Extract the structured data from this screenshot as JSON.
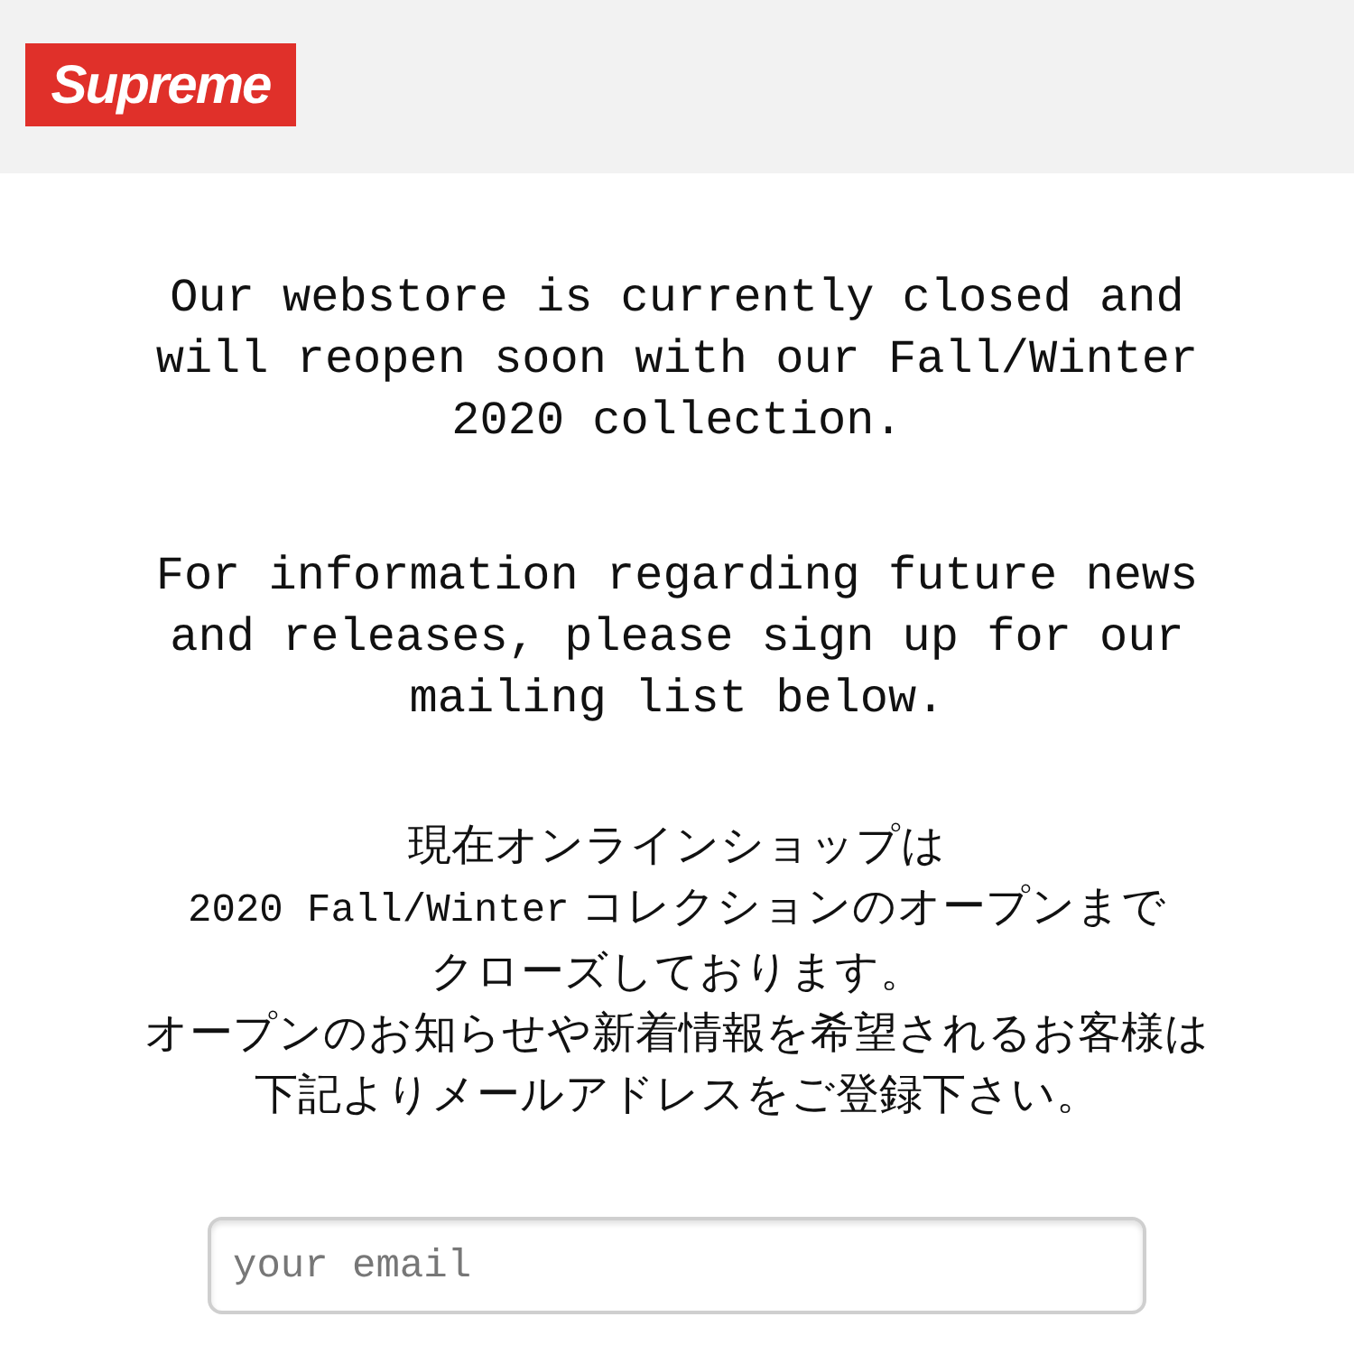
{
  "header": {
    "logo": "Supreme"
  },
  "notice_en": [
    "Our webstore is currently closed and will reopen soon with our Fall/Winter 2020 collection.",
    "For information regarding future news and releases, please sign up for our mailing list below."
  ],
  "notice_ja": [
    [
      {
        "kind": "ja",
        "text": "現在オンラインショップは"
      }
    ],
    [
      {
        "kind": "latin",
        "text": "2020 Fall/Winter"
      },
      {
        "kind": "ja",
        "text": " コレクションのオープンまで"
      }
    ],
    [
      {
        "kind": "ja",
        "text": "クローズしております。"
      }
    ],
    [
      {
        "kind": "ja",
        "text": "オープンのお知らせや新着情報を希望されるお客様は"
      }
    ],
    [
      {
        "kind": "ja",
        "text": "下記よりメールアドレスをご登録下さい。"
      }
    ]
  ],
  "signup": {
    "placeholder": "your email"
  }
}
